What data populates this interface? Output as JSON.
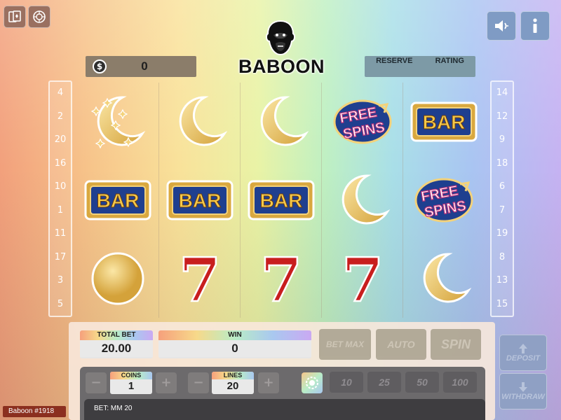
{
  "game": {
    "name": "Baboon",
    "logo_text": "BABOON",
    "instance_tag": "Baboon #1918"
  },
  "top_left_buttons": [
    {
      "icon": "cards-icon"
    },
    {
      "icon": "roulette-icon"
    }
  ],
  "top_right_buttons": [
    {
      "icon": "sound-icon"
    },
    {
      "icon": "info-icon"
    }
  ],
  "balance": {
    "currency_icon": "$",
    "value": "0"
  },
  "tabs": [
    "RESERVE",
    "RATING"
  ],
  "paylines_left": [
    "4",
    "2",
    "20",
    "16",
    "10",
    "1",
    "11",
    "17",
    "3",
    "5"
  ],
  "paylines_right": [
    "14",
    "12",
    "9",
    "18",
    "6",
    "7",
    "19",
    "8",
    "13",
    "15"
  ],
  "reels": [
    [
      "moon-stars",
      "bar",
      "coin"
    ],
    [
      "moon",
      "bar",
      "seven"
    ],
    [
      "moon",
      "bar",
      "seven"
    ],
    [
      "free-spins",
      "moon",
      "seven"
    ],
    [
      "bar",
      "free-spins",
      "moon"
    ]
  ],
  "symbol_text": {
    "bar": "BAR",
    "free_1": "FREE",
    "free_2": "SPINS",
    "seven": "7"
  },
  "bet_panel": {
    "total_bet_label": "TOTAL BET",
    "total_bet": "20.00",
    "win_label": "WIN",
    "win": "0"
  },
  "actions": {
    "bet_max": "BET MAX",
    "auto": "AUTO",
    "spin": "SPIN"
  },
  "coins": {
    "label": "COINS",
    "value": "1"
  },
  "lines": {
    "label": "LINES",
    "value": "20"
  },
  "quick_bets": [
    "10",
    "25",
    "50",
    "100"
  ],
  "bet_info": "BET: MM 20",
  "side_buttons": {
    "deposit": "DEPOSIT",
    "withdraw": "WITHDRAW"
  },
  "colors": {
    "gold": "#e3b64a",
    "bar_blue": "#1f3f8f",
    "seven_red": "#c81e1e"
  }
}
